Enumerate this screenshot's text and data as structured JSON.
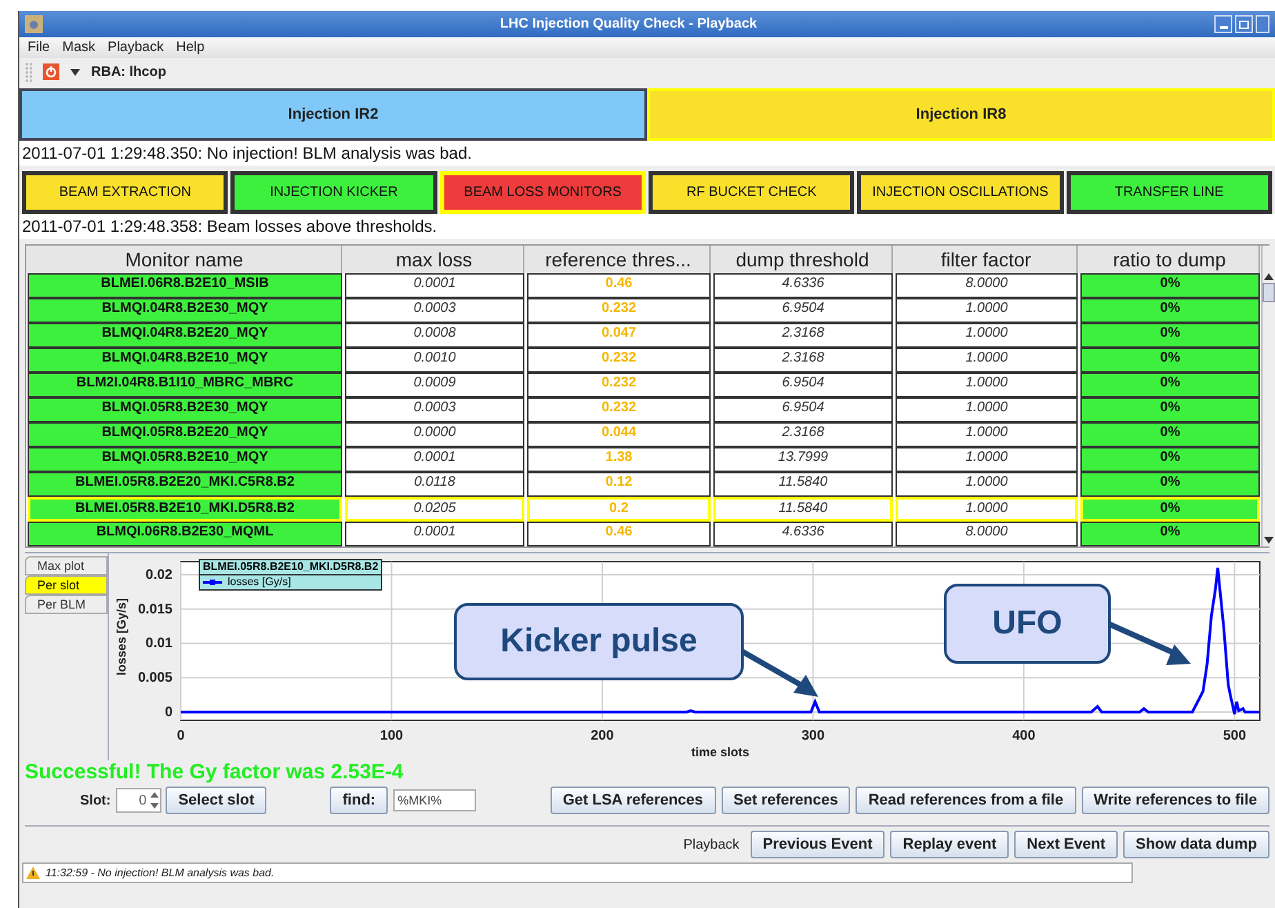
{
  "window": {
    "title": "LHC Injection Quality Check - Playback"
  },
  "menu": [
    "File",
    "Mask",
    "Playback",
    "Help"
  ],
  "toolbar": {
    "rba": "RBA: lhcop"
  },
  "injections": [
    {
      "label": "Injection IR2",
      "color": "#7fc8f8",
      "selected": false
    },
    {
      "label": "Injection IR8",
      "color": "#f9e02b",
      "selected": true
    }
  ],
  "injection_message": "2011-07-01 1:29:48.350: No injection! BLM analysis was bad.",
  "checks": [
    {
      "label": "BEAM EXTRACTION",
      "color": "#f9e02b",
      "selected": false
    },
    {
      "label": "INJECTION KICKER",
      "color": "#3ef03e",
      "selected": false
    },
    {
      "label": "BEAM LOSS MONITORS",
      "color": "#ee3b3b",
      "selected": true
    },
    {
      "label": "RF BUCKET CHECK",
      "color": "#f9e02b",
      "selected": false
    },
    {
      "label": "INJECTION OSCILLATIONS",
      "color": "#f9e02b",
      "selected": false
    },
    {
      "label": "TRANSFER LINE",
      "color": "#3ef03e",
      "selected": false
    }
  ],
  "check_message": "2011-07-01 1:29:48.358: Beam losses above thresholds.",
  "table": {
    "columns": [
      "Monitor name",
      "max loss",
      "reference thres...",
      "dump threshold",
      "filter factor",
      "ratio to dump"
    ],
    "rows": [
      {
        "cells": [
          "BLMEI.06R8.B2E10_MSIB",
          "0.0001",
          "0.46",
          "4.6336",
          "8.0000",
          "0%"
        ],
        "selected": false
      },
      {
        "cells": [
          "BLMQI.04R8.B2E30_MQY",
          "0.0003",
          "0.232",
          "6.9504",
          "1.0000",
          "0%"
        ],
        "selected": false
      },
      {
        "cells": [
          "BLMQI.04R8.B2E20_MQY",
          "0.0008",
          "0.047",
          "2.3168",
          "1.0000",
          "0%"
        ],
        "selected": false
      },
      {
        "cells": [
          "BLMQI.04R8.B2E10_MQY",
          "0.0010",
          "0.232",
          "2.3168",
          "1.0000",
          "0%"
        ],
        "selected": false
      },
      {
        "cells": [
          "BLM2I.04R8.B1I10_MBRC_MBRC",
          "0.0009",
          "0.232",
          "6.9504",
          "1.0000",
          "0%"
        ],
        "selected": false
      },
      {
        "cells": [
          "BLMQI.05R8.B2E30_MQY",
          "0.0003",
          "0.232",
          "6.9504",
          "1.0000",
          "0%"
        ],
        "selected": false
      },
      {
        "cells": [
          "BLMQI.05R8.B2E20_MQY",
          "0.0000",
          "0.044",
          "2.3168",
          "1.0000",
          "0%"
        ],
        "selected": false
      },
      {
        "cells": [
          "BLMQI.05R8.B2E10_MQY",
          "0.0001",
          "1.38",
          "13.7999",
          "1.0000",
          "0%"
        ],
        "selected": false
      },
      {
        "cells": [
          "BLMEI.05R8.B2E20_MKI.C5R8.B2",
          "0.0118",
          "0.12",
          "11.5840",
          "1.0000",
          "0%"
        ],
        "selected": false
      },
      {
        "cells": [
          "BLMEI.05R8.B2E10_MKI.D5R8.B2",
          "0.0205",
          "0.2",
          "11.5840",
          "1.0000",
          "0%"
        ],
        "selected": true
      },
      {
        "cells": [
          "BLMQI.06R8.B2E30_MQML",
          "0.0001",
          "0.46",
          "4.6336",
          "8.0000",
          "0%"
        ],
        "selected": false
      }
    ]
  },
  "plot_tabs": [
    {
      "label": "Max plot",
      "selected": false
    },
    {
      "label": "Per slot",
      "selected": true
    },
    {
      "label": "Per BLM",
      "selected": false
    }
  ],
  "chart": {
    "legend_title": "BLMEI.05R8.B2E10_MKI.D5R8.B2",
    "chart_data": {
      "type": "line",
      "xlabel": "time slots",
      "ylabel": "losses [Gy/s]",
      "xlim": [
        0,
        512
      ],
      "ylim": [
        -0.001,
        0.0215
      ],
      "xticks": [
        0,
        100,
        200,
        300,
        400,
        500
      ],
      "yticks": [
        0,
        0.005,
        0.01,
        0.015,
        0.02
      ],
      "x": [
        0,
        240,
        242,
        244,
        299,
        301,
        303,
        420,
        432,
        435,
        437,
        455,
        457,
        459,
        480,
        485,
        487,
        489,
        491,
        492,
        493,
        495,
        497,
        498,
        500,
        501,
        502,
        504,
        505,
        512
      ],
      "series": [
        {
          "name": "losses [Gy/s]",
          "color": "#0000ff",
          "values": [
            0,
            0,
            0.0002,
            0,
            0,
            0.0015,
            0,
            0,
            0,
            0.0008,
            0,
            0,
            0.0005,
            0,
            0,
            0.003,
            0.007,
            0.014,
            0.018,
            0.021,
            0.018,
            0.012,
            0.004,
            0.0025,
            -0.0003,
            0.0015,
            0.0002,
            0.0005,
            0,
            0
          ]
        }
      ],
      "grid": true,
      "annotations": [
        "Kicker pulse",
        "UFO"
      ]
    }
  },
  "success_message": "Successful! The Gy factor was 2.53E-4",
  "controls": {
    "slot_label": "Slot:",
    "slot_value": "0",
    "select_slot": "Select slot",
    "find": "find:",
    "find_value": "%MKI%",
    "buttons": [
      "Get LSA references",
      "Set references",
      "Read references from a file",
      "Write references to file"
    ]
  },
  "playback": {
    "label": "Playback",
    "buttons": [
      "Previous Event",
      "Replay event",
      "Next Event",
      "Show data dump"
    ]
  },
  "status_bar": {
    "message": "11:32:59 - No injection! BLM analysis was bad."
  }
}
